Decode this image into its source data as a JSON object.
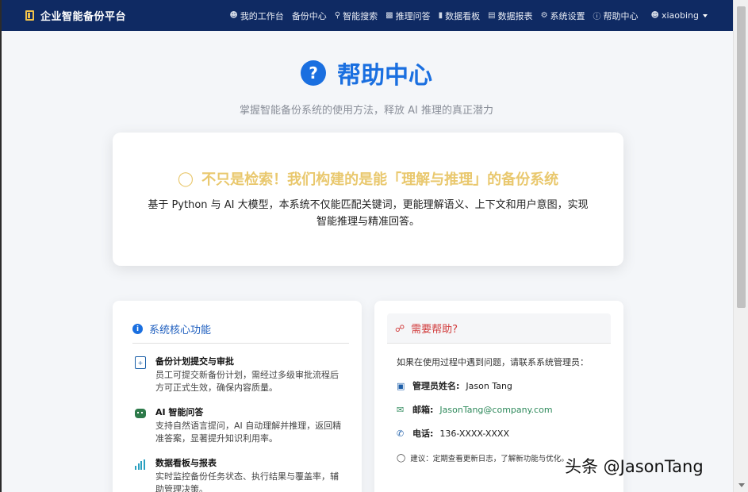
{
  "navbar": {
    "brand": "企业智能备份平台",
    "items": [
      {
        "icon": "user-icon",
        "label": "我的工作台"
      },
      {
        "icon": "",
        "label": "备份中心"
      },
      {
        "icon": "search-icon",
        "label": "智能搜索"
      },
      {
        "icon": "robot-icon",
        "label": "推理问答"
      },
      {
        "icon": "bar-chart-icon",
        "label": "数据看板"
      },
      {
        "icon": "report-icon",
        "label": "数据报表"
      },
      {
        "icon": "gear-icon",
        "label": "系统设置"
      },
      {
        "icon": "question-icon",
        "label": "帮助中心"
      }
    ],
    "user": "xiaobing"
  },
  "hero": {
    "title": "帮助中心",
    "subtitle": "掌握智能备份系统的使用方法，释放 AI 推理的真正潜力"
  },
  "intro": {
    "headline": "不只是检索！我们构建的是能「理解与推理」的备份系统",
    "body": "基于 Python 与 AI 大模型，本系统不仅能匹配关键词，更能理解语义、上下文和用户意图，实现智能推理与精准回答。"
  },
  "features": {
    "title": "系统核心功能",
    "items": [
      {
        "title": "备份计划提交与审批",
        "desc": "员工可提交新备份计划，需经过多级审批流程后方可正式生效，确保内容质量。"
      },
      {
        "title": "AI 智能问答",
        "desc": "支持自然语言提问，AI 自动理解并推理，返回精准答案，显著提升知识利用率。"
      },
      {
        "title": "数据看板与报表",
        "desc": "实时监控备份任务状态、执行结果与覆盖率，辅助管理决策。"
      }
    ]
  },
  "help": {
    "title": "需要帮助?",
    "intro": "如果在使用过程中遇到问题，请联系系统管理员：",
    "admin_label": "管理员姓名:",
    "admin_name": "Jason Tang",
    "email_label": "邮箱:",
    "email": "JasonTang@company.com",
    "phone_label": "电话:",
    "phone": "136-XXXX-XXXX",
    "tip": "建议：定期查看更新日志，了解新功能与优化。"
  },
  "watermark": "头条 @JasonTang"
}
